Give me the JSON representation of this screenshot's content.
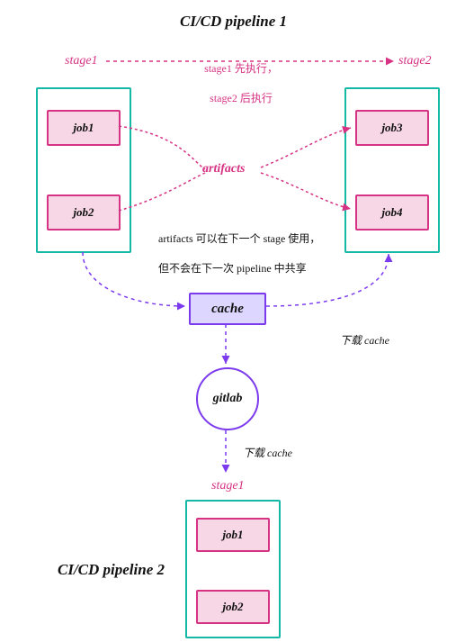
{
  "title1": "CI/CD pipeline 1",
  "title2": "CI/CD pipeline 2",
  "stage1_label": "stage1",
  "stage2_label": "stage2",
  "stage_order_note_l1": "stage1 先执行，",
  "stage_order_note_l2": "stage2 后执行",
  "artifacts_label": "artifacts",
  "artifacts_note_l1": "artifacts 可以在下一个 stage 使用，",
  "artifacts_note_l2": "但不会在下一次 pipeline 中共享",
  "cache_label": "cache",
  "gitlab_label": "gitlab",
  "download_cache": "下载 cache",
  "p2_stage_label": "stage1",
  "jobs": {
    "p1s1j1": "job1",
    "p1s1j2": "job2",
    "p1s2j3": "job3",
    "p1s2j4": "job4",
    "p2s1j1": "job1",
    "p2s1j2": "job2"
  }
}
